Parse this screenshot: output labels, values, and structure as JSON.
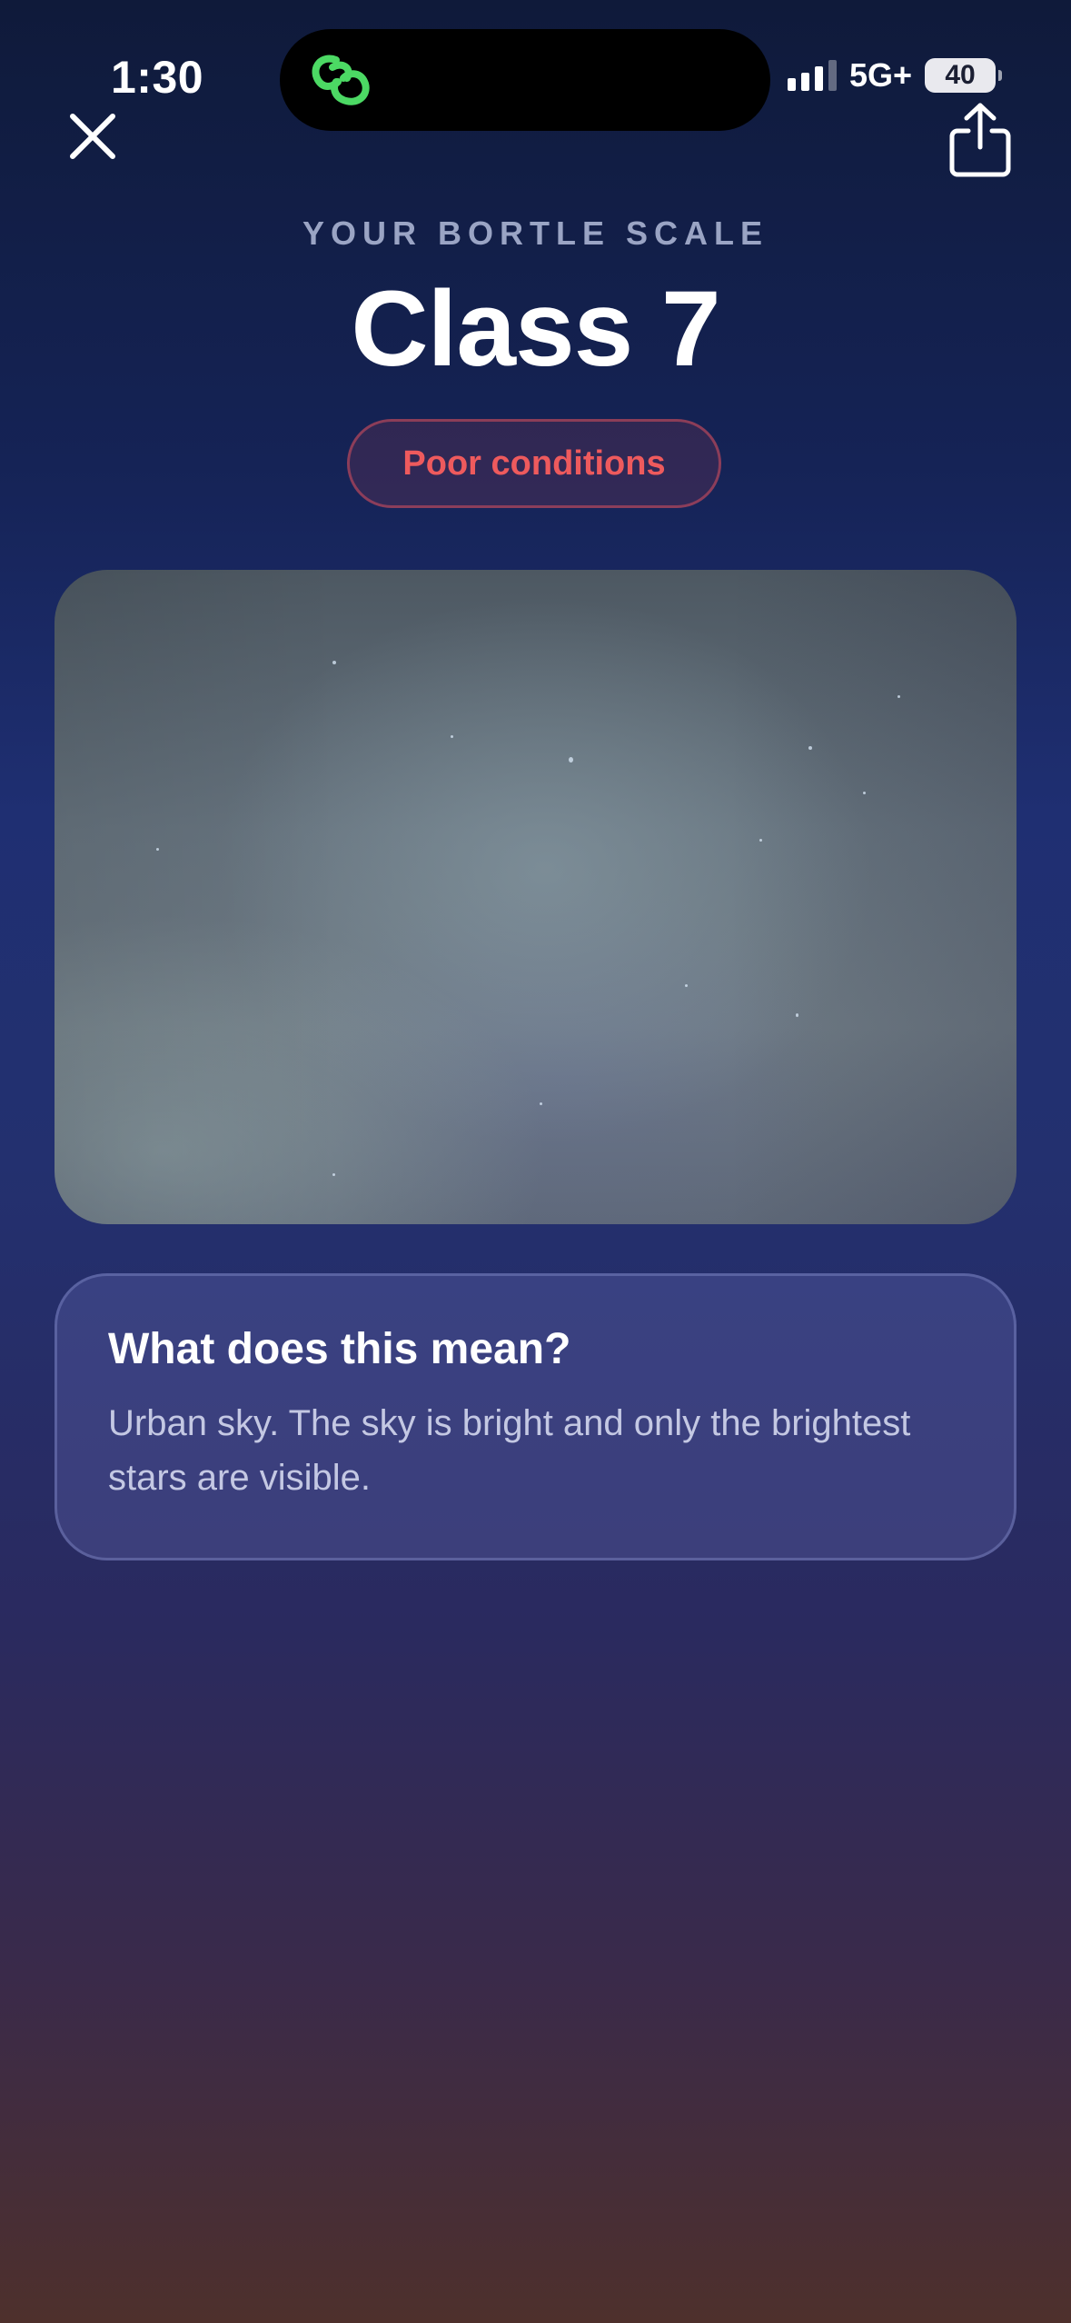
{
  "status_bar": {
    "time": "1:30",
    "network": "5G+",
    "battery": "40",
    "island_app_icon": "link-rings-icon"
  },
  "toolbar": {
    "close_icon": "close-icon",
    "share_icon": "share-icon"
  },
  "header": {
    "eyebrow": "YOUR BORTLE SCALE",
    "title": "Class 7",
    "badge": "Poor conditions"
  },
  "colors": {
    "badge_text": "#ee5a5d",
    "island_icon": "#4cd964",
    "eyebrow_text": "#9aa4c4"
  },
  "info_card": {
    "heading": "What does this mean?",
    "body": "Urban sky. The sky is bright and only the brightest stars are visible."
  }
}
